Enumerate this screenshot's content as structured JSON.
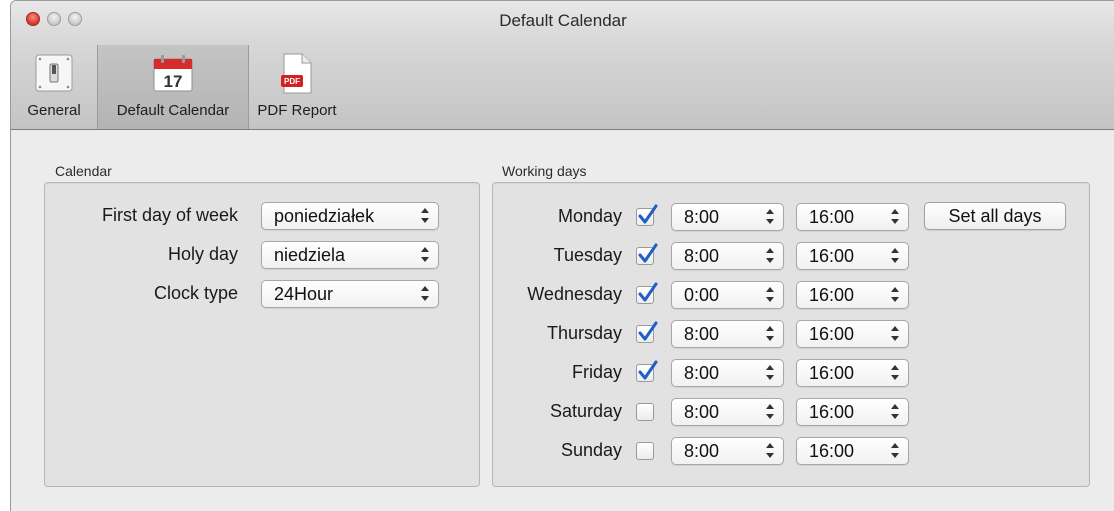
{
  "window": {
    "title": "Default Calendar"
  },
  "toolbar": {
    "items": [
      {
        "label": "General"
      },
      {
        "label": "Default Calendar",
        "icon_text": "17"
      },
      {
        "label": "PDF Report",
        "icon_text": "PDF"
      }
    ]
  },
  "calendar": {
    "group_label": "Calendar",
    "first_day_label": "First day of week",
    "first_day_value": "poniedziałek",
    "holy_day_label": "Holy day",
    "holy_day_value": "niedziela",
    "clock_type_label": "Clock type",
    "clock_type_value": "24Hour"
  },
  "working_days": {
    "group_label": "Working days",
    "set_all_label": "Set all days",
    "days": [
      {
        "name": "Monday",
        "checked": true,
        "start": "8:00",
        "end": "16:00"
      },
      {
        "name": "Tuesday",
        "checked": true,
        "start": "8:00",
        "end": "16:00"
      },
      {
        "name": "Wednesday",
        "checked": true,
        "start": "0:00",
        "end": "16:00"
      },
      {
        "name": "Thursday",
        "checked": true,
        "start": "8:00",
        "end": "16:00"
      },
      {
        "name": "Friday",
        "checked": true,
        "start": "8:00",
        "end": "16:00"
      },
      {
        "name": "Saturday",
        "checked": false,
        "start": "8:00",
        "end": "16:00"
      },
      {
        "name": "Sunday",
        "checked": false,
        "start": "8:00",
        "end": "16:00"
      }
    ]
  }
}
